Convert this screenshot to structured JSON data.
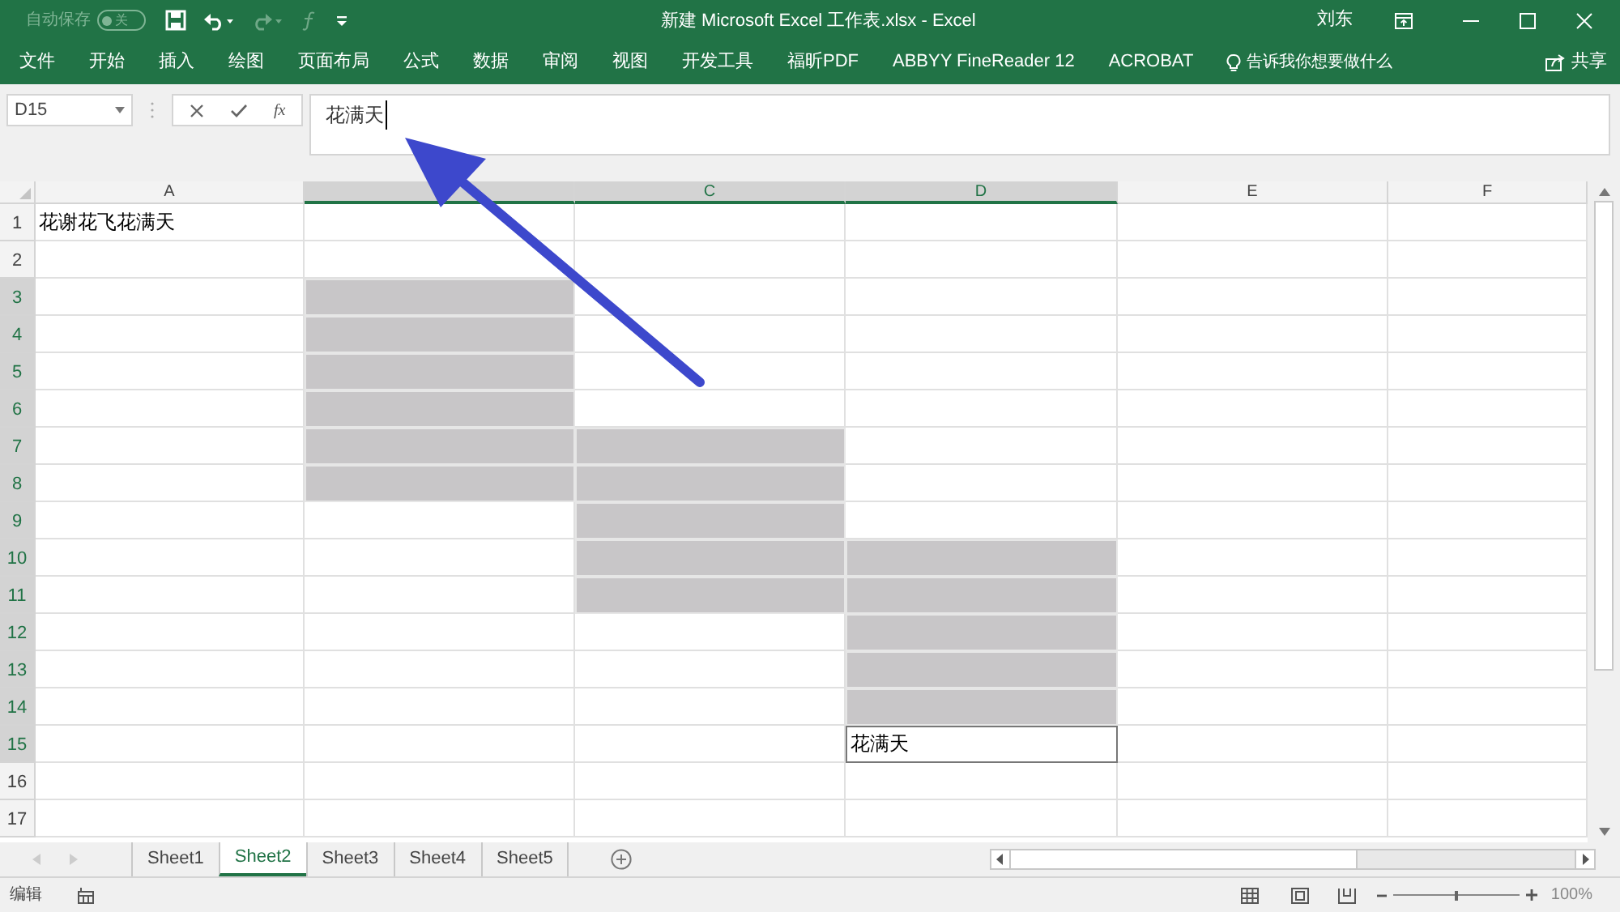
{
  "title_bar": {
    "autosave": {
      "label": "自动保存",
      "state_label": "关",
      "on": false
    },
    "quick_access": [
      {
        "kind": "save",
        "disabled": false
      },
      {
        "kind": "undo",
        "disabled": false
      },
      {
        "kind": "redo",
        "disabled": true
      },
      {
        "kind": "function",
        "disabled": true
      },
      {
        "kind": "customize",
        "disabled": false
      }
    ],
    "title": "新建 Microsoft Excel 工作表.xlsx - Excel",
    "user": "刘东"
  },
  "ribbon_tabs": [
    {
      "label": "文件"
    },
    {
      "label": "开始"
    },
    {
      "label": "插入"
    },
    {
      "label": "绘图"
    },
    {
      "label": "页面布局"
    },
    {
      "label": "公式"
    },
    {
      "label": "数据"
    },
    {
      "label": "审阅"
    },
    {
      "label": "视图"
    },
    {
      "label": "开发工具"
    },
    {
      "label": "福昕PDF"
    },
    {
      "label": "ABBYY FineReader 12"
    },
    {
      "label": "ACROBAT"
    }
  ],
  "tell_me": {
    "placeholder": "告诉我你想要做什么"
  },
  "share": "共享",
  "formula_bar": {
    "name_box": "D15",
    "function_button": "fx",
    "value": "花满天"
  },
  "columns": [
    {
      "label": "A",
      "highlighted": false
    },
    {
      "highlighted": true
    },
    {
      "label": "C",
      "highlighted": true
    },
    {
      "label": "D",
      "highlighted": true
    },
    {
      "label": "E",
      "highlighted": false
    },
    {
      "label": "F",
      "highlighted": false
    }
  ],
  "rows": [
    {
      "number": "1",
      "highlighted": false,
      "cells": [
        {
          "text": "花谢花飞花满天",
          "filled": false,
          "active": false
        },
        {
          "filled": false,
          "active": false
        },
        {
          "filled": false,
          "active": false
        },
        {
          "filled": false,
          "active": false
        },
        {
          "filled": false,
          "active": false
        },
        {
          "filled": false,
          "active": false
        }
      ]
    },
    {
      "number": "2",
      "highlighted": false,
      "cells": [
        {
          "filled": false,
          "active": false
        },
        {
          "filled": false,
          "active": false
        },
        {
          "filled": false,
          "active": false
        },
        {
          "filled": false,
          "active": false
        },
        {
          "filled": false,
          "active": false
        },
        {
          "filled": false,
          "active": false
        }
      ]
    },
    {
      "number": "3",
      "highlighted": true,
      "cells": [
        {
          "filled": false,
          "active": false
        },
        {
          "filled": true,
          "active": false
        },
        {
          "filled": false,
          "active": false
        },
        {
          "filled": false,
          "active": false
        },
        {
          "filled": false,
          "active": false
        },
        {
          "filled": false,
          "active": false
        }
      ]
    },
    {
      "number": "4",
      "highlighted": true,
      "cells": [
        {
          "filled": false,
          "active": false
        },
        {
          "filled": true,
          "active": false
        },
        {
          "filled": false,
          "active": false
        },
        {
          "filled": false,
          "active": false
        },
        {
          "filled": false,
          "active": false
        },
        {
          "filled": false,
          "active": false
        }
      ]
    },
    {
      "number": "5",
      "highlighted": true,
      "cells": [
        {
          "filled": false,
          "active": false
        },
        {
          "filled": true,
          "active": false
        },
        {
          "filled": false,
          "active": false
        },
        {
          "filled": false,
          "active": false
        },
        {
          "filled": false,
          "active": false
        },
        {
          "filled": false,
          "active": false
        }
      ]
    },
    {
      "number": "6",
      "highlighted": true,
      "cells": [
        {
          "filled": false,
          "active": false
        },
        {
          "filled": true,
          "active": false
        },
        {
          "filled": false,
          "active": false
        },
        {
          "filled": false,
          "active": false
        },
        {
          "filled": false,
          "active": false
        },
        {
          "filled": false,
          "active": false
        }
      ]
    },
    {
      "number": "7",
      "highlighted": true,
      "cells": [
        {
          "filled": false,
          "active": false
        },
        {
          "filled": true,
          "active": false
        },
        {
          "filled": true,
          "active": false
        },
        {
          "filled": false,
          "active": false
        },
        {
          "filled": false,
          "active": false
        },
        {
          "filled": false,
          "active": false
        }
      ]
    },
    {
      "number": "8",
      "highlighted": true,
      "cells": [
        {
          "filled": false,
          "active": false
        },
        {
          "filled": true,
          "active": false
        },
        {
          "filled": true,
          "active": false
        },
        {
          "filled": false,
          "active": false
        },
        {
          "filled": false,
          "active": false
        },
        {
          "filled": false,
          "active": false
        }
      ]
    },
    {
      "number": "9",
      "highlighted": true,
      "cells": [
        {
          "filled": false,
          "active": false
        },
        {
          "filled": false,
          "active": false
        },
        {
          "filled": true,
          "active": false
        },
        {
          "filled": false,
          "active": false
        },
        {
          "filled": false,
          "active": false
        },
        {
          "filled": false,
          "active": false
        }
      ]
    },
    {
      "number": "10",
      "highlighted": true,
      "cells": [
        {
          "filled": false,
          "active": false
        },
        {
          "filled": false,
          "active": false
        },
        {
          "filled": true,
          "active": false
        },
        {
          "filled": true,
          "active": false
        },
        {
          "filled": false,
          "active": false
        },
        {
          "filled": false,
          "active": false
        }
      ]
    },
    {
      "number": "11",
      "highlighted": true,
      "cells": [
        {
          "filled": false,
          "active": false
        },
        {
          "filled": false,
          "active": false
        },
        {
          "filled": true,
          "active": false
        },
        {
          "filled": true,
          "active": false
        },
        {
          "filled": false,
          "active": false
        },
        {
          "filled": false,
          "active": false
        }
      ]
    },
    {
      "number": "12",
      "highlighted": true,
      "cells": [
        {
          "filled": false,
          "active": false
        },
        {
          "filled": false,
          "active": false
        },
        {
          "filled": false,
          "active": false
        },
        {
          "filled": true,
          "active": false
        },
        {
          "filled": false,
          "active": false
        },
        {
          "filled": false,
          "active": false
        }
      ]
    },
    {
      "number": "13",
      "highlighted": true,
      "cells": [
        {
          "filled": false,
          "active": false
        },
        {
          "filled": false,
          "active": false
        },
        {
          "filled": false,
          "active": false
        },
        {
          "filled": true,
          "active": false
        },
        {
          "filled": false,
          "active": false
        },
        {
          "filled": false,
          "active": false
        }
      ]
    },
    {
      "number": "14",
      "highlighted": true,
      "cells": [
        {
          "filled": false,
          "active": false
        },
        {
          "filled": false,
          "active": false
        },
        {
          "filled": false,
          "active": false
        },
        {
          "filled": true,
          "active": false
        },
        {
          "filled": false,
          "active": false
        },
        {
          "filled": false,
          "active": false
        }
      ]
    },
    {
      "number": "15",
      "highlighted": true,
      "cells": [
        {
          "filled": false,
          "active": false
        },
        {
          "filled": false,
          "active": false
        },
        {
          "filled": false,
          "active": false
        },
        {
          "text": "花满天",
          "filled": false,
          "active": true
        },
        {
          "filled": false,
          "active": false
        },
        {
          "filled": false,
          "active": false
        }
      ]
    },
    {
      "number": "16",
      "highlighted": false,
      "cells": [
        {
          "filled": false,
          "active": false
        },
        {
          "filled": false,
          "active": false
        },
        {
          "filled": false,
          "active": false
        },
        {
          "filled": false,
          "active": false
        },
        {
          "filled": false,
          "active": false
        },
        {
          "filled": false,
          "active": false
        }
      ]
    },
    {
      "number": "17",
      "highlighted": false,
      "cells": [
        {
          "filled": false,
          "active": false
        },
        {
          "filled": false,
          "active": false
        },
        {
          "filled": false,
          "active": false
        },
        {
          "filled": false,
          "active": false
        },
        {
          "filled": false,
          "active": false
        },
        {
          "filled": false,
          "active": false
        }
      ]
    }
  ],
  "sheet_tabs": [
    {
      "label": "Sheet1",
      "selected": false
    },
    {
      "label": "Sheet2",
      "selected": true
    },
    {
      "label": "Sheet3",
      "selected": false
    },
    {
      "label": "Sheet4",
      "selected": false
    },
    {
      "label": "Sheet5",
      "selected": false
    }
  ],
  "status_bar": {
    "mode": "编辑",
    "zoom": {
      "level": 0.5,
      "reading": "100%"
    }
  }
}
